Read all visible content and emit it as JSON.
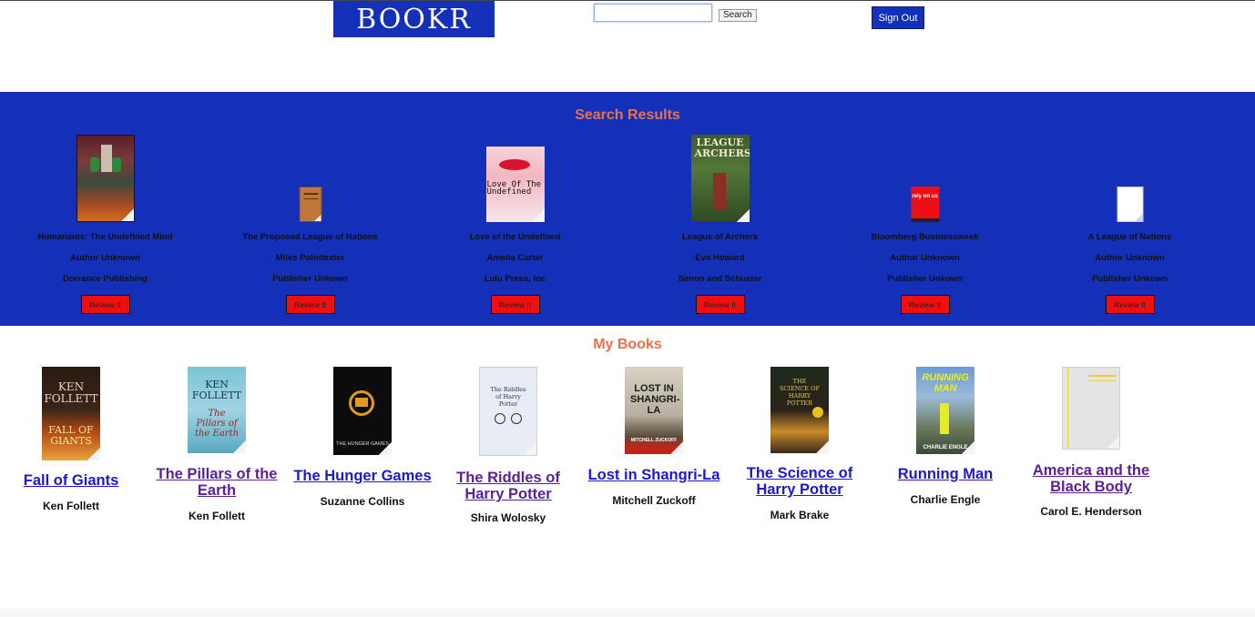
{
  "header": {
    "logo_text": "BOOKR",
    "search": {
      "value": "",
      "placeholder": ""
    },
    "search_button": "Search",
    "signout_button": "Sign Out"
  },
  "search_results": {
    "title": "Search Results",
    "review_label": "Review It",
    "items": [
      {
        "title": "Humanants: The Undefined Mind",
        "author": "Author Unknown",
        "publisher": "Dorrance Publishing"
      },
      {
        "title": "The Proposed League of Nations",
        "author": "Miles Poindexter",
        "publisher": "Publisher Unkown"
      },
      {
        "title": "Love of the Undefined",
        "author": "Amelia Carter",
        "publisher": "Lulu Press, Inc",
        "cover_text": "Love Of The Undefined"
      },
      {
        "title": "League of Archers",
        "author": "Eva Howard",
        "publisher": "Simon and Schuster",
        "cover_text": "LEAGUE ARCHERS"
      },
      {
        "title": "Bloomberg Businessweek",
        "author": "Author Unknown",
        "publisher": "Publisher Unkown",
        "cover_text": "rely on us"
      },
      {
        "title": "A League of Nations",
        "author": "Author Unknown",
        "publisher": "Publisher Unkown"
      }
    ]
  },
  "my_books": {
    "title": "My Books",
    "items": [
      {
        "title": "Fall of Giants",
        "author": "Ken Follett",
        "cover_top": "KEN FOLLETT",
        "cover_bottom": "FALL OF GIANTS"
      },
      {
        "title": "The Pillars of the Earth",
        "author": "Ken Follett",
        "cover_top": "KEN FOLLETT",
        "cover_bottom": "The Pillars of the Earth"
      },
      {
        "title": "The Hunger Games",
        "author": "Suzanne Collins",
        "cover_bottom": "THE HUNGER GAMES"
      },
      {
        "title": "The Riddles of Harry Potter",
        "author": "Shira Wolosky",
        "cover_top": "The Riddles of Harry Potter"
      },
      {
        "title": "Lost in Shangri-La",
        "author": "Mitchell Zuckoff",
        "cover_top": "LOST IN SHANGRI-LA",
        "cover_bottom": "MITCHELL ZUCKOFF"
      },
      {
        "title": "The Science of Harry Potter",
        "author": "Mark Brake",
        "cover_top": "THE SCIENCE OF HARRY POTTER"
      },
      {
        "title": "Running Man",
        "author": "Charlie Engle",
        "cover_top": "RUNNING MAN",
        "cover_bottom": "CHARLIE ENGLE"
      },
      {
        "title": "America and the Black Body",
        "author": "Carol E. Henderson"
      }
    ]
  },
  "colors": {
    "brand_blue": "#1530b8",
    "accent_orange": "#e8714a",
    "review_red": "#ee0f0f",
    "link_purple": "#5a1f99",
    "link_blue": "#1b18d6"
  }
}
